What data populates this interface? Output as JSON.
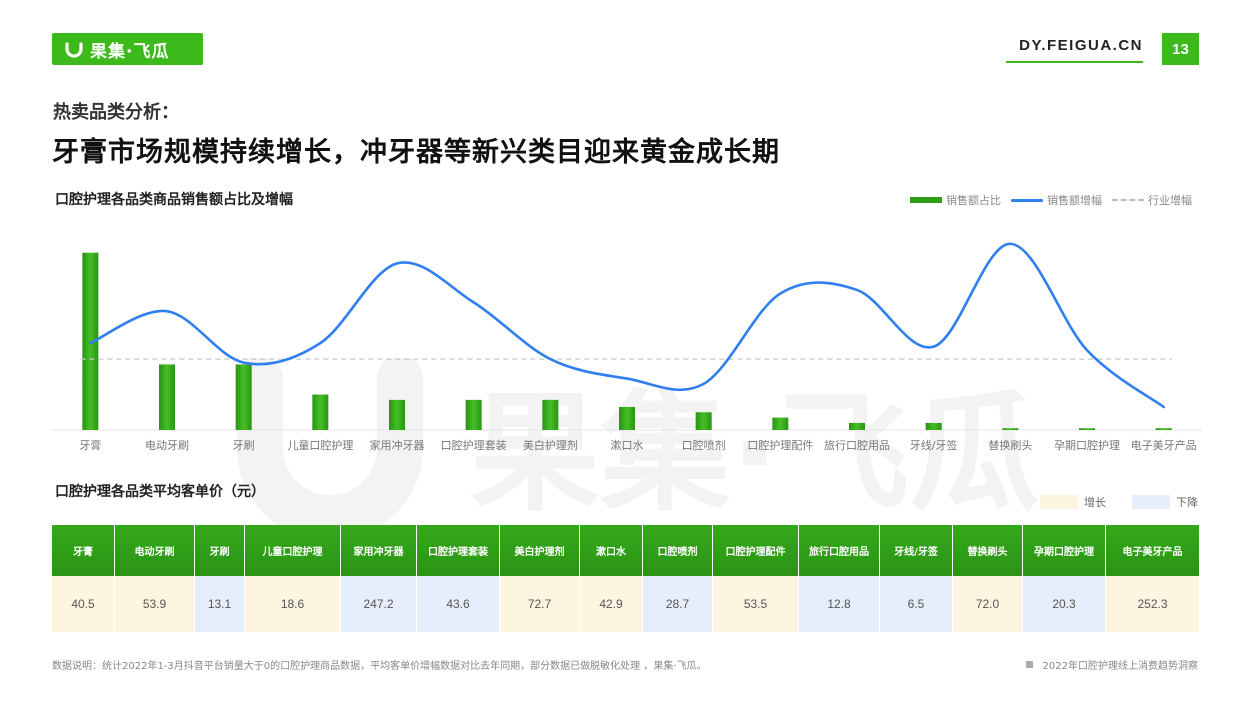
{
  "header": {
    "logo_text": "果集·飞瓜",
    "site_url": "DY.FEIGUA.CN",
    "page_number": "13"
  },
  "subtitle": "热卖品类分析：",
  "headline": "牙膏市场规模持续增长，冲牙器等新兴类目迎来黄金成长期",
  "colors": {
    "brand_green": "#3dba1b",
    "bar_green": "#2e9e18",
    "line_blue": "#2f7ff0",
    "increase_bg": "#fdf5df",
    "decrease_bg": "#e6eefb"
  },
  "chart_data": {
    "type": "bar",
    "title": "口腔护理各品类商品销售额占比及增幅",
    "categories": [
      "牙膏",
      "电动牙刷",
      "牙刷",
      "儿童口腔护理",
      "家用冲牙器",
      "口腔护理套装",
      "美白护理剂",
      "漱口水",
      "口腔喷剂",
      "口腔护理配件",
      "旅行口腔用品",
      "牙线/牙签",
      "替换刷头",
      "孕期口腔护理",
      "电子美牙产品"
    ],
    "series": [
      {
        "name": "销售额占比",
        "type": "bar",
        "values": [
          100,
          37,
          37,
          20,
          17,
          17,
          17,
          13,
          10,
          7,
          4,
          4,
          1,
          1,
          1
        ]
      },
      {
        "name": "销售额增幅",
        "type": "line",
        "values": [
          49,
          67,
          38,
          49,
          94,
          72,
          40,
          29,
          26,
          77,
          79,
          47,
          105,
          45,
          13
        ]
      }
    ],
    "reference_lines": [
      {
        "name": "行业增幅",
        "value": 40
      }
    ],
    "ylim": [
      0,
      110
    ],
    "xlabel": "",
    "ylabel": "",
    "grid": false,
    "legend": "top-right",
    "axes_values_shown": false
  },
  "table": {
    "title": "口腔护理各品类平均客单价（元）",
    "legend_up": "增长",
    "legend_down": "下降",
    "columns": [
      {
        "header": "牙膏",
        "value": "40.5",
        "trend": "up"
      },
      {
        "header": "电动牙刷",
        "value": "53.9",
        "trend": "up"
      },
      {
        "header": "牙刷",
        "value": "13.1",
        "trend": "down"
      },
      {
        "header": "儿童口腔护理",
        "value": "18.6",
        "trend": "up"
      },
      {
        "header": "家用冲牙器",
        "value": "247.2",
        "trend": "down"
      },
      {
        "header": "口腔护理套装",
        "value": "43.6",
        "trend": "down"
      },
      {
        "header": "美白护理剂",
        "value": "72.7",
        "trend": "up"
      },
      {
        "header": "漱口水",
        "value": "42.9",
        "trend": "up"
      },
      {
        "header": "口腔喷剂",
        "value": "28.7",
        "trend": "down"
      },
      {
        "header": "口腔护理配件",
        "value": "53.5",
        "trend": "up"
      },
      {
        "header": "旅行口腔用品",
        "value": "12.8",
        "trend": "down"
      },
      {
        "header": "牙线/牙签",
        "value": "6.5",
        "trend": "down"
      },
      {
        "header": "替换刷头",
        "value": "72.0",
        "trend": "up"
      },
      {
        "header": "孕期口腔护理",
        "value": "20.3",
        "trend": "down"
      },
      {
        "header": "电子美牙产品",
        "value": "252.3",
        "trend": "up"
      }
    ]
  },
  "footer": {
    "note": "数据说明：统计2022年1-3月抖音平台销量大于0的口腔护理商品数据，平均客单价增幅数据对比去年同期，部分数据已做脱敏化处理 ，果集·飞瓜。",
    "report_title": "2022年口腔护理线上消费趋势洞察"
  },
  "watermark": {
    "text": "果集·飞瓜"
  }
}
